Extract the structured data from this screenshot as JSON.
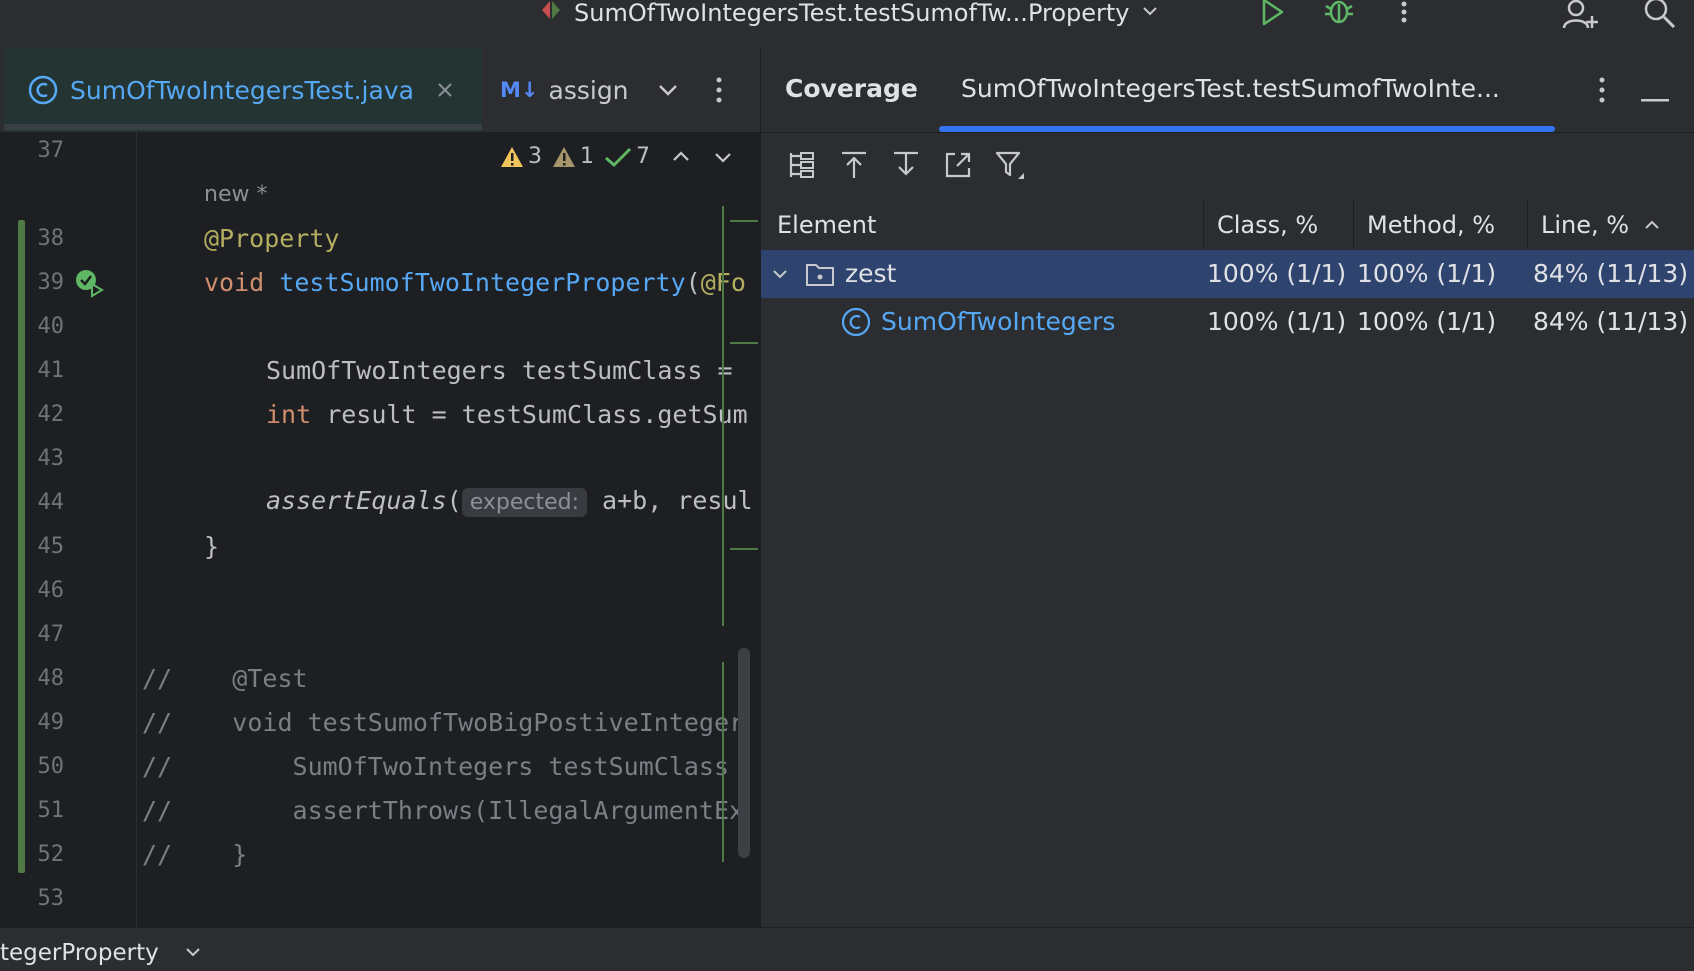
{
  "titlebar": {
    "run_config": "SumOfTwoIntegersTest.testSumofTw...Property"
  },
  "editor_tabs": [
    {
      "label": "SumOfTwoIntegersTest.java",
      "icon": "class-icon"
    },
    {
      "label": "assign",
      "icon": "markdown-icon",
      "icon_text": "M↓"
    }
  ],
  "inspections": {
    "warnings": "3",
    "weak_warnings": "1",
    "ok": "7"
  },
  "editor": {
    "line_numbers": [
      "37",
      "38",
      "39",
      "40",
      "41",
      "42",
      "43",
      "44",
      "45",
      "46",
      "47",
      "48",
      "49",
      "50",
      "51",
      "52",
      "53"
    ],
    "new_marker": "new *",
    "l38": "@Property",
    "l39_kw": "void ",
    "l39_fn": "testSumofTwoIntegerProperty",
    "l39_rest": "(",
    "l39_ann": "@Fo",
    "l41": "SumOfTwoIntegers testSumClass =",
    "l42_kw": "int",
    "l42_rest": " result = testSumClass.getSum",
    "l44_fn": "assertEquals",
    "l44_open": "(",
    "l44_hint": "expected:",
    "l44_rest": " a+b, resul",
    "l45": "}",
    "l48": "//    @Test",
    "l49": "//    void testSumofTwoBigPostiveInteger",
    "l50": "//        SumOfTwoIntegers testSumClass",
    "l51": "//        assertThrows(IllegalArgumentEx",
    "l52": "//    }"
  },
  "coverage": {
    "title": "Coverage",
    "tab": "SumOfTwoIntegersTest.testSumofTwoInte...",
    "columns": [
      "Element",
      "Class, %",
      "Method, %",
      "Line, %"
    ],
    "rows": [
      {
        "element": "zest",
        "class_pct": "100% (1/1)",
        "method_pct": "100% (1/1)",
        "line_pct": "84% (11/13)"
      },
      {
        "element": "SumOfTwoIntegers",
        "class_pct": "100% (1/1)",
        "method_pct": "100% (1/1)",
        "line_pct": "84% (11/13)"
      }
    ]
  },
  "statusbar": {
    "text": "tegerProperty"
  },
  "colors": {
    "accent": "#3574f0",
    "selection": "#2e436e",
    "vcs_added": "#4f7a45"
  }
}
